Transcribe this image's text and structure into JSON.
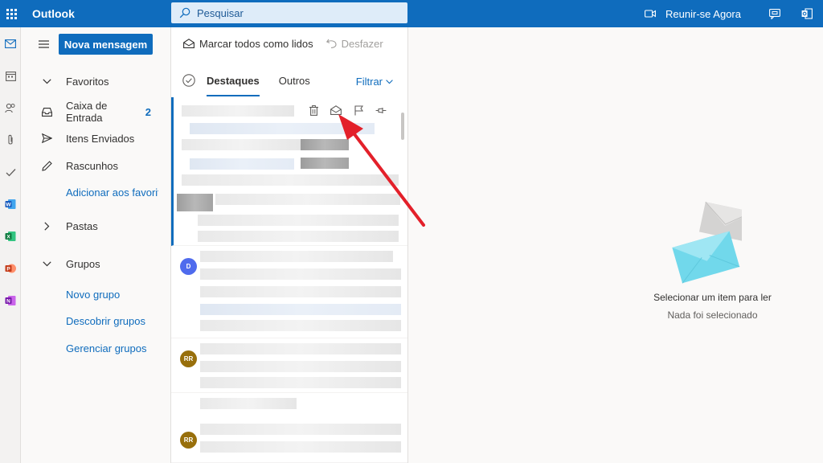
{
  "topbar": {
    "app_title": "Outlook",
    "search_placeholder": "Pesquisar",
    "meet_label": "Reunir-se Agora"
  },
  "folders": {
    "new_message": "Nova mensagem",
    "favorites_header": "Favoritos",
    "inbox_label": "Caixa de Entrada",
    "inbox_count": "2",
    "sent_label": "Itens Enviados",
    "drafts_label": "Rascunhos",
    "add_favorite": "Adicionar aos favoritos",
    "folders_header": "Pastas",
    "groups_header": "Grupos",
    "new_group": "Novo grupo",
    "discover_groups": "Descobrir grupos",
    "manage_groups": "Gerenciar grupos"
  },
  "commands": {
    "mark_all_read": "Marcar todos como lidos",
    "undo": "Desfazer"
  },
  "list": {
    "tab_focused": "Destaques",
    "tab_other": "Outros",
    "filter_label": "Filtrar",
    "messages": [
      {
        "avatar": ""
      },
      {
        "avatar": "D",
        "color": "#4f6bed"
      },
      {
        "avatar": "RR",
        "color": "#986f0b"
      },
      {
        "avatar": "RR",
        "color": "#986f0b"
      }
    ]
  },
  "reading": {
    "title": "Selecionar um item para ler",
    "subtitle": "Nada foi selecionado"
  },
  "colors": {
    "brand": "#0f6cbd",
    "annotation_arrow": "#e3202a"
  }
}
